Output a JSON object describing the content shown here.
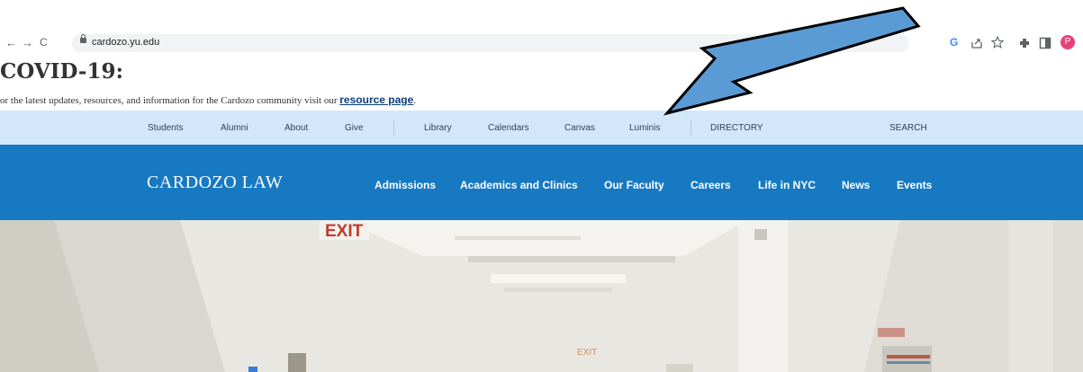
{
  "browser": {
    "url": "cardozo.yu.edu",
    "avatar_letter": "P",
    "back_glyph": "←",
    "forward_glyph": "→",
    "reload_glyph": "C"
  },
  "covid": {
    "heading": "COVID-19:",
    "text": "or the latest updates, resources, and information for the Cardozo community visit our",
    "link": "resource page",
    "period": "."
  },
  "utility_nav": {
    "students": "Students",
    "alumni": "Alumni",
    "about": "About",
    "give": "Give",
    "library": "Library",
    "calendars": "Calendars",
    "canvas": "Canvas",
    "luminis": "Luminis",
    "directory": "DIRECTORY",
    "search": "SEARCH"
  },
  "main_nav": {
    "logo": "CARDOZO LAW",
    "admissions": "Admissions",
    "academics": "Academics and Clinics",
    "faculty": "Our Faculty",
    "careers": "Careers",
    "nyc": "Life in NYC",
    "news": "News",
    "events": "Events"
  },
  "hero": {
    "exit_sign_1": "EXIT",
    "exit_sign_2": "EXIT"
  },
  "colors": {
    "utility_bar": "#d2e8fa",
    "main_nav": "#1879c3",
    "arrow": "#5b9bd5"
  }
}
